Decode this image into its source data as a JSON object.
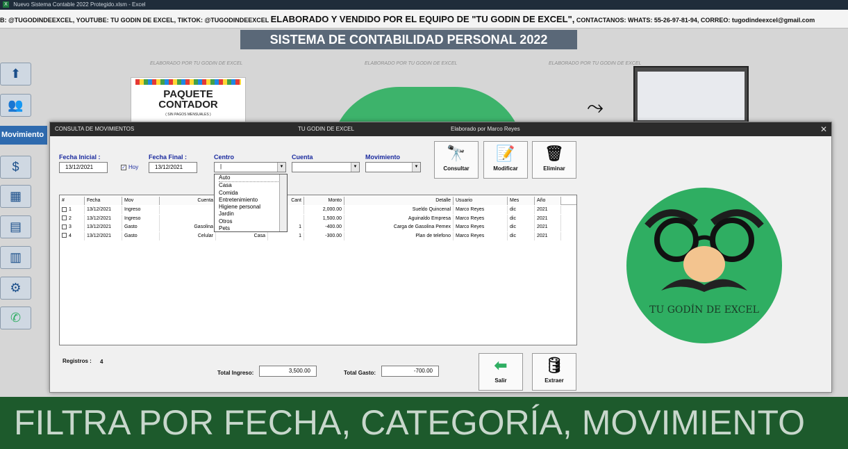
{
  "window": {
    "title": "Nuevo Sistema Contable 2022 Protegido.xlsm - Excel"
  },
  "banner": {
    "left_text": "B: @TUGODINDEEXCEL, YOUTUBE: TU GODIN DE EXCEL, TIKTOK: @TUGODINDEEXCEL",
    "big_text": "ELABORADO Y VENDIDO POR EL EQUIPO DE \"TU GODIN DE EXCEL\",",
    "right_text": "CONTACTANOS: WHATS: 55-26-97-81-94, CORREO: tugodindeexcel@gmail.com"
  },
  "sheet": {
    "header": "SISTEMA DE CONTABILIDAD PERSONAL 2022",
    "credits": [
      "ELABORADO POR TU GODIN DE EXCEL",
      "ELABORADO POR TU GODIN DE EXCEL",
      "ELABORADO POR TU GODIN DE EXCEL"
    ],
    "paquete_title": "PAQUETE CONTADOR",
    "paquete_sub": "( SIN PAGOS MENSUALES )",
    "movimiento_button": "Movimiento",
    "left_icons": [
      "upload-icon",
      "people-money-icon",
      "coin-icon",
      "calculator-icon",
      "presentation-icon",
      "bar-chart-icon",
      "gears-icon",
      "whatsapp-icon"
    ]
  },
  "dialog": {
    "title_left": "CONSULTA DE MOVIMIENTOS",
    "title_center": "TU GODIN DE EXCEL",
    "title_right": "Elaborado por Marco Reyes",
    "fecha_inicial_label": "Fecha Inicial :",
    "fecha_inicial_value": "13/12/2021",
    "hoy_label": "Hoy",
    "fecha_final_label": "Fecha Final :",
    "fecha_final_value": "13/12/2021",
    "centro_label": "Centro",
    "cuenta_label": "Cuenta",
    "movimiento_label": "Movimiento",
    "centro_options": [
      "Auto",
      "Casa",
      "Comida",
      "Entretenimiento",
      "Higiene personal",
      "Jardin",
      "Otros",
      "Pets"
    ],
    "buttons": {
      "consultar": "Consultar",
      "modificar": "Modificar",
      "eliminar": "Eliminar",
      "salir": "Salir",
      "extraer": "Extraer"
    },
    "grid": {
      "columns": [
        "#",
        "Fecha",
        "Mov",
        "Cuenta",
        "",
        "Cant",
        "Monto",
        "Detalle",
        "Usuario",
        "Mes",
        "Año"
      ],
      "rows": [
        [
          "1",
          "13/12/2021",
          "Ingreso",
          "",
          "",
          "",
          "2,000.00",
          "Sueldo Quincenal",
          "Marco Reyes",
          "dic",
          "2021"
        ],
        [
          "2",
          "13/12/2021",
          "Ingreso",
          "",
          "",
          "",
          "1,500.00",
          "Aguinaldo Empresa",
          "Marco Reyes",
          "dic",
          "2021"
        ],
        [
          "3",
          "13/12/2021",
          "Gasto",
          "Gasolina",
          "",
          "1",
          "-400.00",
          "Carga de Gasolina Pemex",
          "Marco Reyes",
          "dic",
          "2021"
        ],
        [
          "4",
          "13/12/2021",
          "Gasto",
          "Celular",
          "Casa",
          "1",
          "-300.00",
          "Plan de telefono",
          "Marco Reyes",
          "dic",
          "2021"
        ]
      ]
    },
    "registros_label": "Registros :",
    "registros_value": "4",
    "total_ingreso_label": "Total Ingreso:",
    "total_ingreso_value": "3,500.00",
    "total_gasto_label": "Total Gasto:",
    "total_gasto_value": "-700.00",
    "logo_text": "TU GODÍN DE EXCEL"
  },
  "caption": "FILTRA POR FECHA, CATEGORÍA, MOVIMIENTO"
}
